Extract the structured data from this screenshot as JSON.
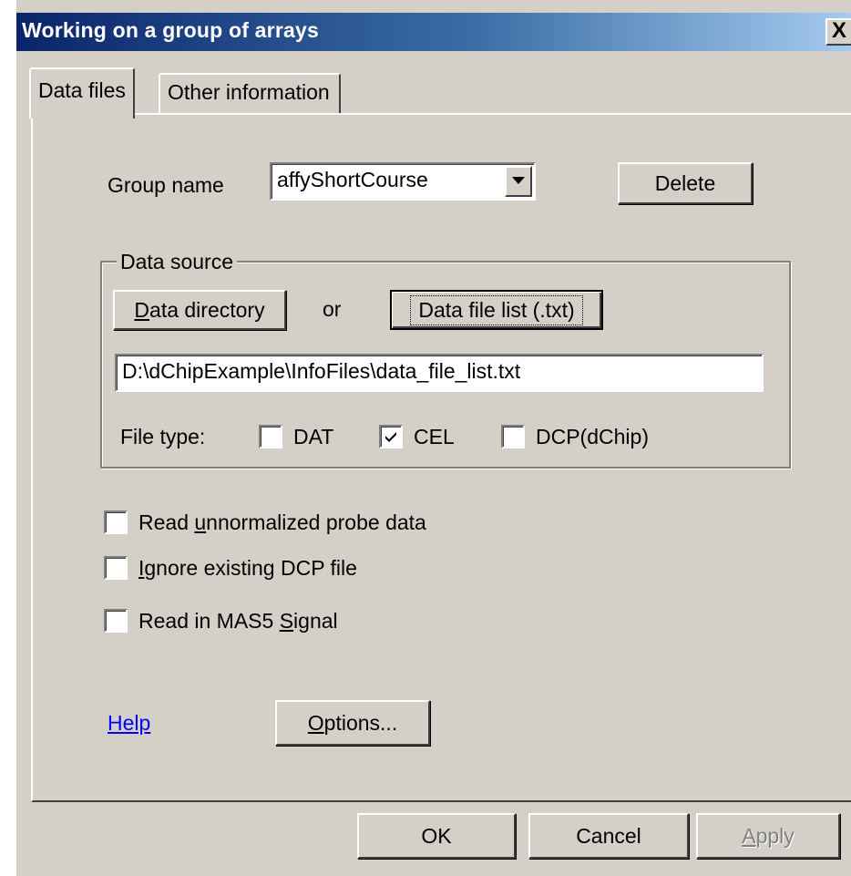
{
  "window": {
    "title": "Working on a group of arrays",
    "close_label": "X"
  },
  "tabs": [
    {
      "label": "Data files",
      "active": true
    },
    {
      "label": "Other information",
      "active": false
    }
  ],
  "group": {
    "label": "Group name",
    "value": "affyShortCourse",
    "delete_label": "Delete"
  },
  "data_source": {
    "legend": "Data source",
    "directory_button": {
      "mnemonic": "D",
      "rest": "ata directory"
    },
    "or_text": "or",
    "file_list_button": "Data file list (.txt)",
    "path": "D:\\dChipExample\\InfoFiles\\data_file_list.txt",
    "file_type_label": "File type:",
    "file_types": [
      {
        "label": "DAT",
        "checked": false
      },
      {
        "label": "CEL",
        "checked": true
      },
      {
        "label": "DCP(dChip)",
        "checked": false
      }
    ]
  },
  "options": [
    {
      "pre": "Read ",
      "mnemonic": "u",
      "post": "nnormalized probe data",
      "checked": false
    },
    {
      "pre": "",
      "mnemonic": "I",
      "post": "gnore existing DCP file",
      "checked": false
    },
    {
      "pre": "Read in MAS5 ",
      "mnemonic": "S",
      "post": "ignal",
      "checked": false
    }
  ],
  "help_link": "Help",
  "options_button": {
    "mnemonic": "O",
    "rest": "ptions..."
  },
  "footer": {
    "ok": "OK",
    "cancel": "Cancel",
    "apply_mnemonic": "A",
    "apply_rest": "pply"
  }
}
